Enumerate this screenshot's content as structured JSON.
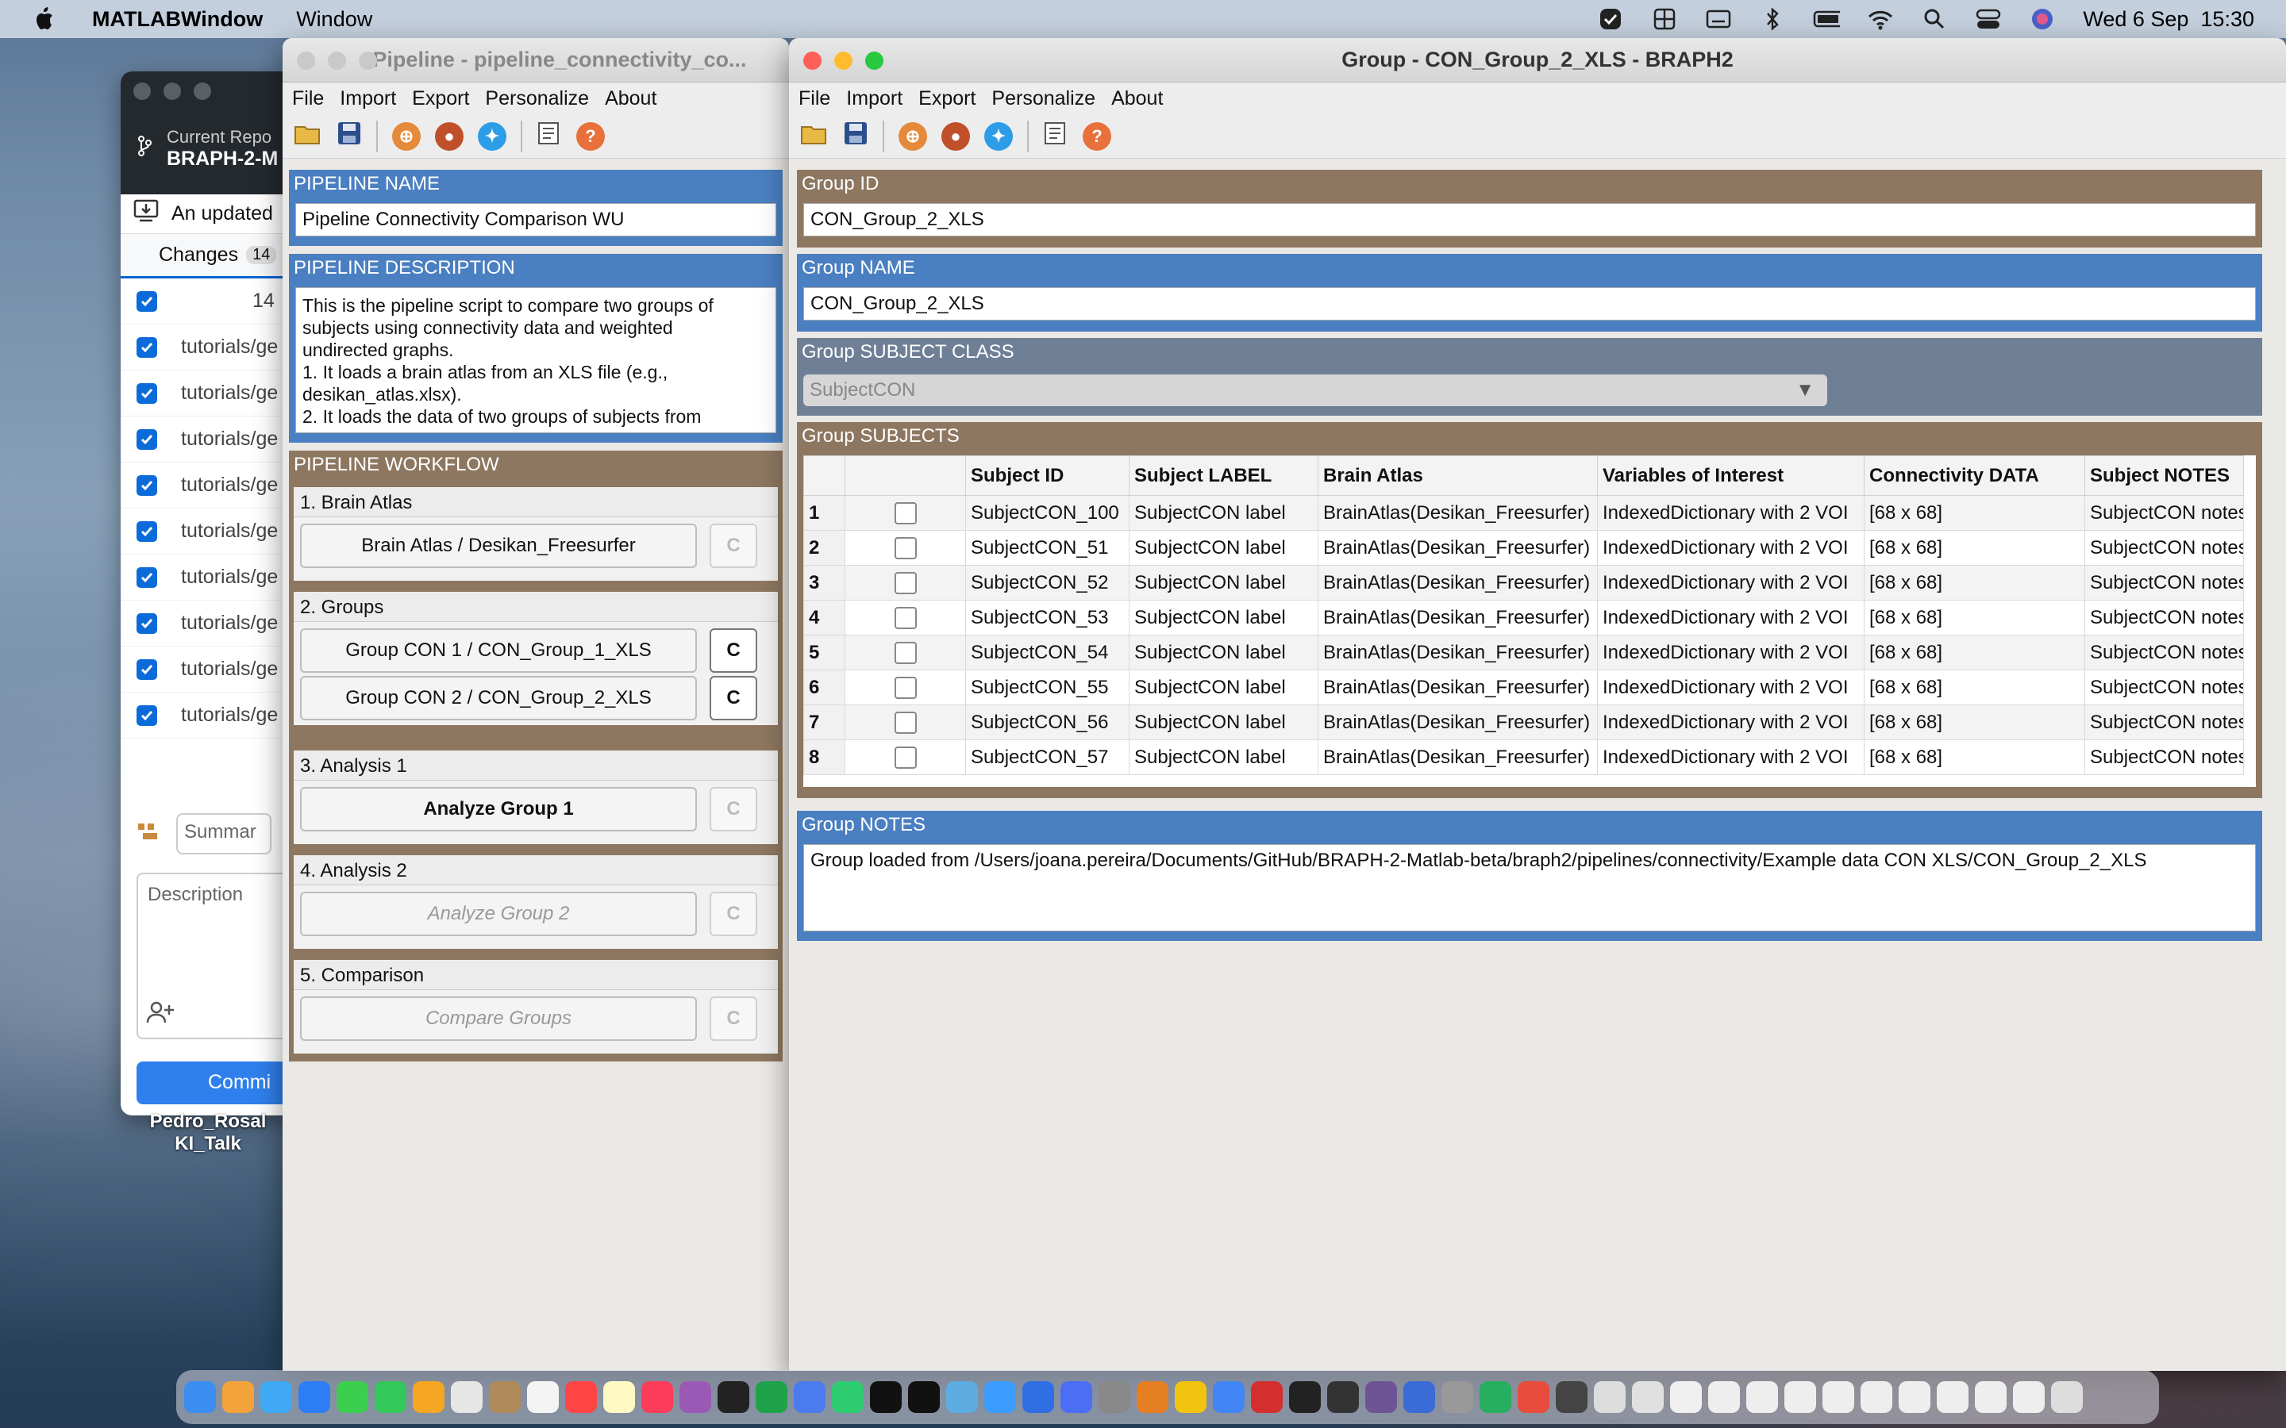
{
  "menubar": {
    "app": "MATLABWindow",
    "window": "Window",
    "datetime": "Wed 6 Sep  15:30"
  },
  "github": {
    "repo_label": "Current Repo",
    "repo_name": "BRAPH-2-M",
    "update": "An updated",
    "changes_tab": "Changes",
    "changes_count": "14",
    "all_count": "14",
    "file_prefix": "tutorials/ge",
    "summary_placeholder": "Summar",
    "description_placeholder": "Description",
    "commit_label": "Commi"
  },
  "desktop": {
    "label1": "Pedro_Rosal",
    "label2": "KI_Talk"
  },
  "pipeline": {
    "title": "Pipeline - pipeline_connectivity_co...",
    "menu": [
      "File",
      "Import",
      "Export",
      "Personalize",
      "About"
    ],
    "name_header": "PIPELINE NAME",
    "name_value": "Pipeline Connectivity Comparison WU",
    "desc_header": "PIPELINE DESCRIPTION",
    "desc_lines": [
      "This is the pipeline script to compare two groups of",
      "subjects using connectivity data and weighted",
      "undirected graphs.",
      "1. It loads a brain atlas from an XLS file (e.g.,",
      "desikan_atlas.xlsx).",
      "2. It loads the data of two groups of subjects from"
    ],
    "workflow_header": "PIPELINE WORKFLOW",
    "sections": [
      {
        "head": "1. Brain Atlas",
        "buttons": [
          {
            "label": "Brain Atlas / Desikan_Freesurfer",
            "c": "C"
          }
        ]
      },
      {
        "head": "2. Groups",
        "buttons": [
          {
            "label": "Group CON 1 / CON_Group_1_XLS",
            "c": "C"
          },
          {
            "label": "Group CON 2 / CON_Group_2_XLS",
            "c": "C"
          }
        ]
      },
      {
        "head": "3. Analysis 1",
        "buttons": [
          {
            "label": "Analyze Group 1",
            "c": "C"
          }
        ]
      },
      {
        "head": "4. Analysis 2",
        "buttons": [
          {
            "label": "Analyze Group 2",
            "c": "C"
          }
        ]
      },
      {
        "head": "5. Comparison",
        "buttons": [
          {
            "label": "Compare Groups",
            "c": "C"
          }
        ]
      }
    ]
  },
  "group": {
    "title": "Group - CON_Group_2_XLS - BRAPH2",
    "menu": [
      "File",
      "Import",
      "Export",
      "Personalize",
      "About"
    ],
    "id_header": "Group ID",
    "id_value": "CON_Group_2_XLS",
    "name_header": "Group NAME",
    "name_value": "CON_Group_2_XLS",
    "class_header": "Group SUBJECT CLASS",
    "class_value": "SubjectCON",
    "subjects_header": "Group SUBJECTS",
    "columns": [
      "",
      "",
      "Subject ID",
      "Subject LABEL",
      "Brain Atlas",
      "Variables of Interest",
      "Connectivity DATA",
      "Subject NOTES"
    ],
    "rows": [
      [
        "1",
        "SubjectCON_100",
        "SubjectCON label",
        "BrainAtlas(Desikan_Freesurfer)",
        "IndexedDictionary with 2 VOI",
        "[68 x 68]",
        "SubjectCON notes"
      ],
      [
        "2",
        "SubjectCON_51",
        "SubjectCON label",
        "BrainAtlas(Desikan_Freesurfer)",
        "IndexedDictionary with 2 VOI",
        "[68 x 68]",
        "SubjectCON notes"
      ],
      [
        "3",
        "SubjectCON_52",
        "SubjectCON label",
        "BrainAtlas(Desikan_Freesurfer)",
        "IndexedDictionary with 2 VOI",
        "[68 x 68]",
        "SubjectCON notes"
      ],
      [
        "4",
        "SubjectCON_53",
        "SubjectCON label",
        "BrainAtlas(Desikan_Freesurfer)",
        "IndexedDictionary with 2 VOI",
        "[68 x 68]",
        "SubjectCON notes"
      ],
      [
        "5",
        "SubjectCON_54",
        "SubjectCON label",
        "BrainAtlas(Desikan_Freesurfer)",
        "IndexedDictionary with 2 VOI",
        "[68 x 68]",
        "SubjectCON notes"
      ],
      [
        "6",
        "SubjectCON_55",
        "SubjectCON label",
        "BrainAtlas(Desikan_Freesurfer)",
        "IndexedDictionary with 2 VOI",
        "[68 x 68]",
        "SubjectCON notes"
      ],
      [
        "7",
        "SubjectCON_56",
        "SubjectCON label",
        "BrainAtlas(Desikan_Freesurfer)",
        "IndexedDictionary with 2 VOI",
        "[68 x 68]",
        "SubjectCON notes"
      ],
      [
        "8",
        "SubjectCON_57",
        "SubjectCON label",
        "BrainAtlas(Desikan_Freesurfer)",
        "IndexedDictionary with 2 VOI",
        "[68 x 68]",
        "SubjectCON notes"
      ]
    ],
    "notes_header": "Group NOTES",
    "notes_value": "Group loaded from /Users/joana.pereira/Documents/GitHub/BRAPH-2-Matlab-beta/braph2/pipelines/connectivity/Example data CON XLS/CON_Group_2_XLS"
  },
  "colors": {
    "blue": "#4a7fc1",
    "brown": "#8e7760",
    "slate": "#6e7f96"
  }
}
